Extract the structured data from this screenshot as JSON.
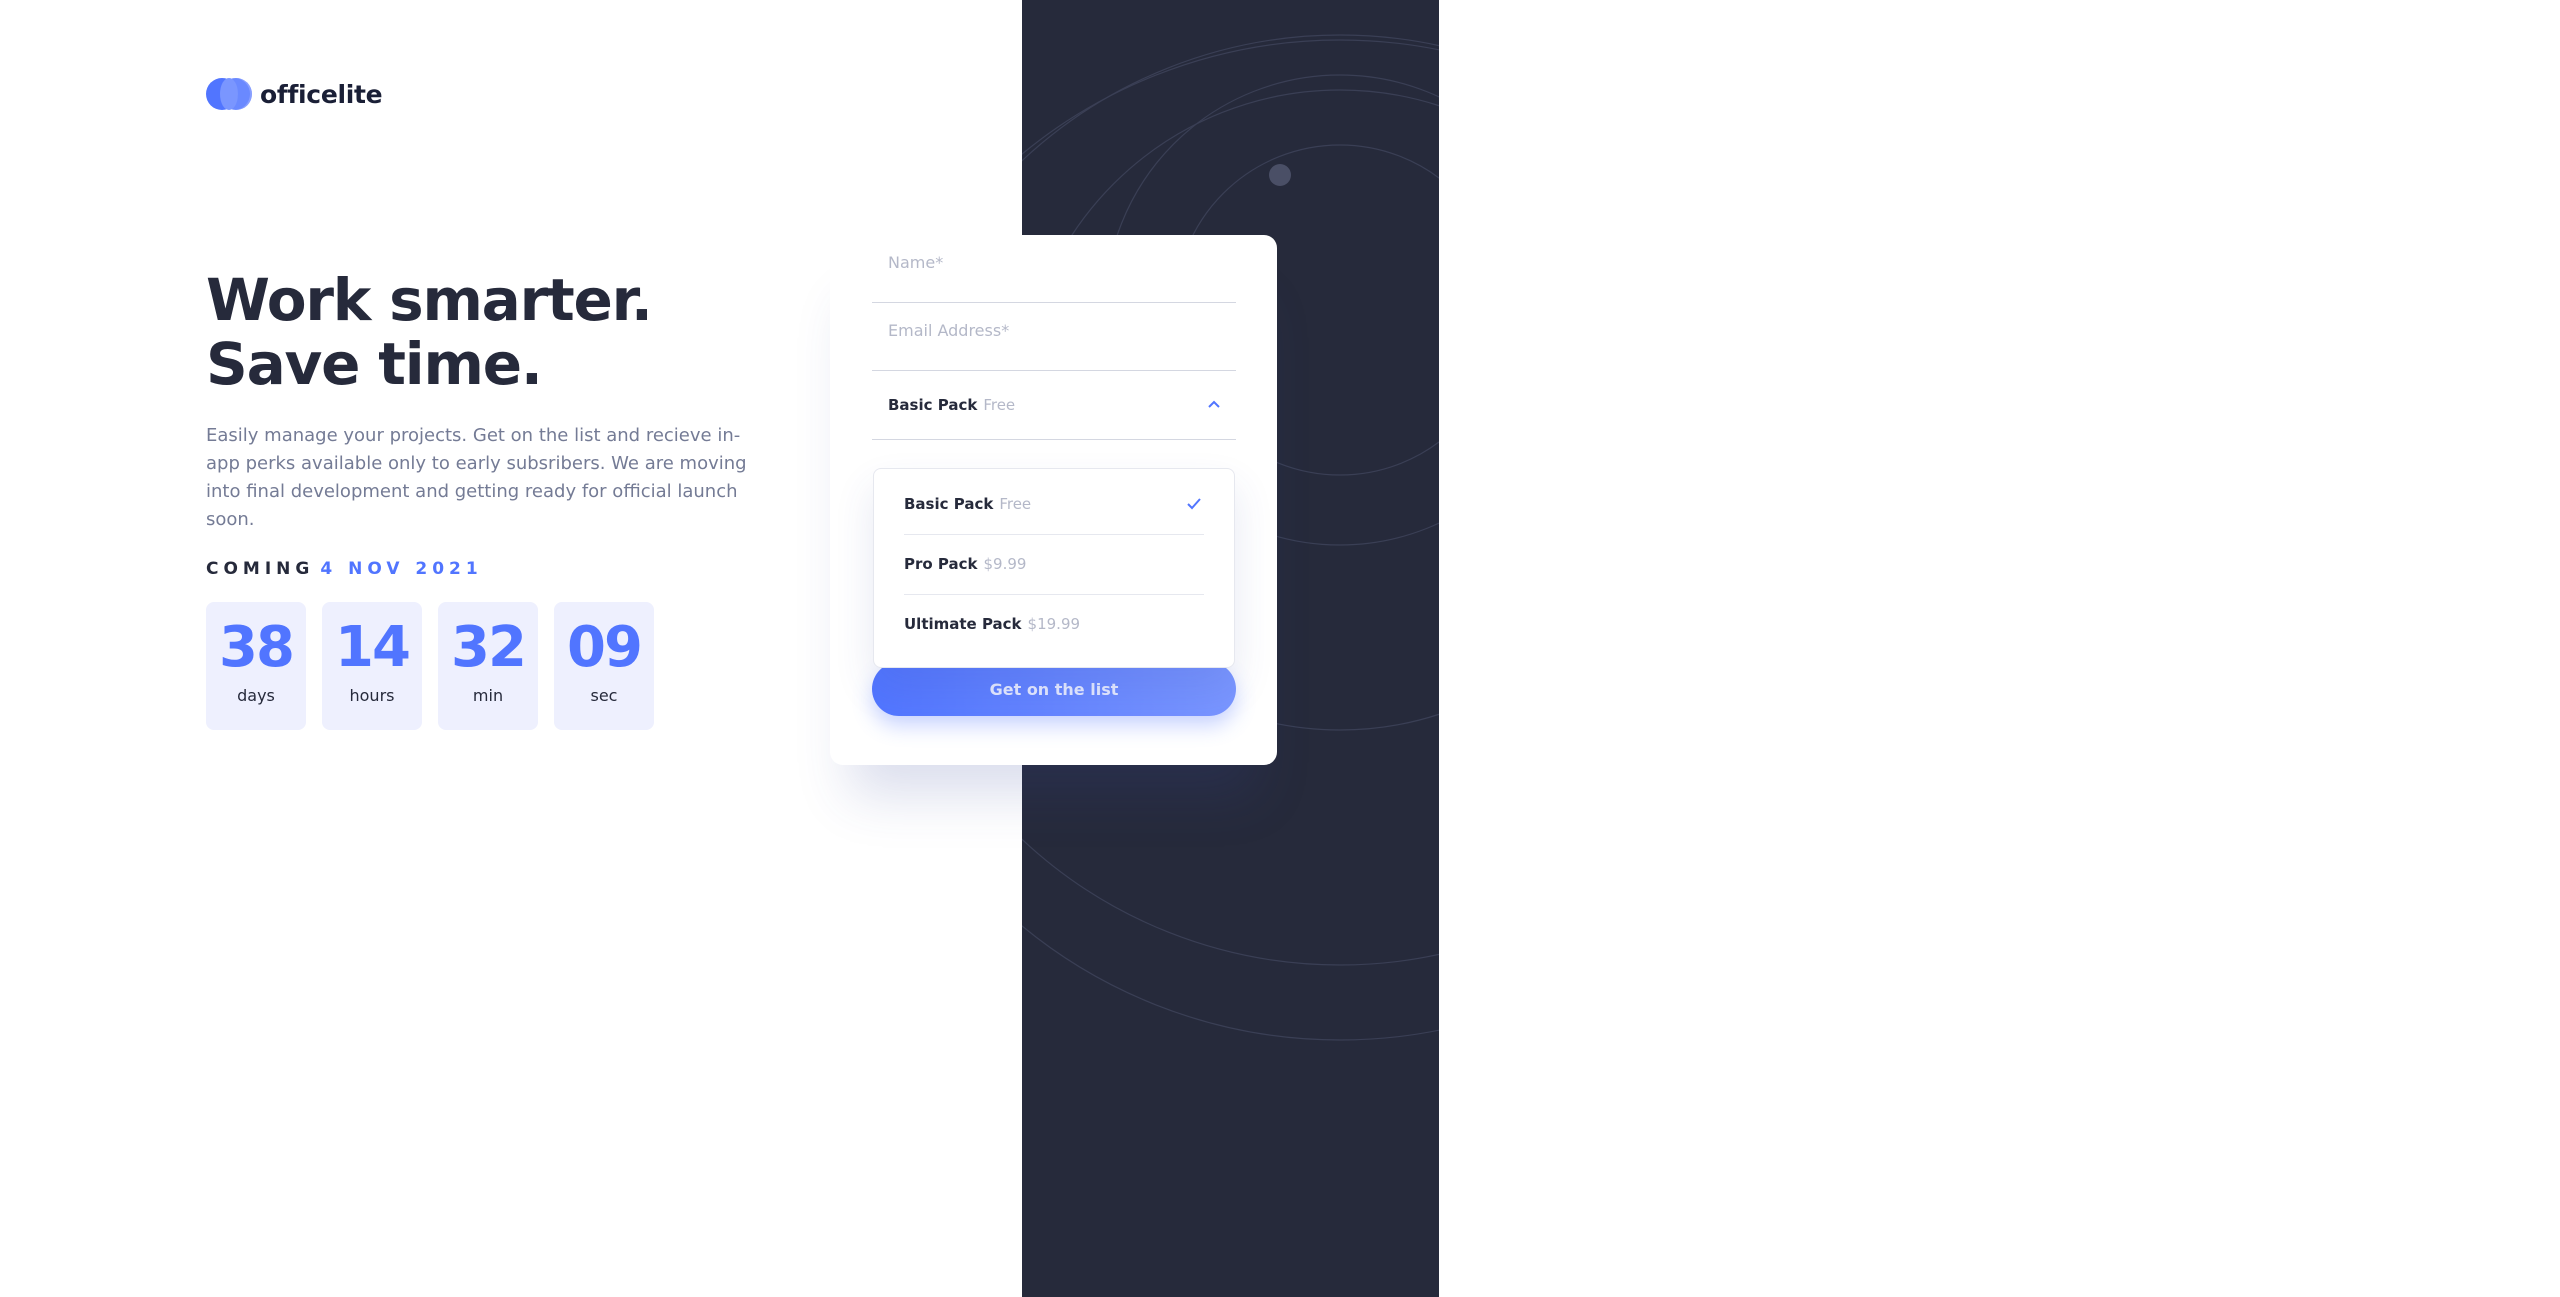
{
  "brand": {
    "name": "officelite",
    "accent": "#5175ff",
    "dark": "#262a3b"
  },
  "hero": {
    "headline": "Work smarter. Save time.",
    "intro": "Easily manage your projects. Get on the list and recieve in-app perks available only to early subsribers. We are moving into final development and getting ready for official launch soon."
  },
  "coming": {
    "label": "COMING",
    "date": "4 NOV 2021"
  },
  "countdown": [
    {
      "value": "38",
      "label": "days"
    },
    {
      "value": "14",
      "label": "hours"
    },
    {
      "value": "32",
      "label": "min"
    },
    {
      "value": "09",
      "label": "sec"
    }
  ],
  "form": {
    "name_placeholder": "Name*",
    "email_placeholder": "Email Address*",
    "select": {
      "selected_name": "Basic Pack",
      "selected_price": "Free",
      "expanded": true
    },
    "options": [
      {
        "name": "Basic Pack",
        "price": "Free",
        "selected": true
      },
      {
        "name": "Pro Pack",
        "price": "$9.99",
        "selected": false
      },
      {
        "name": "Ultimate Pack",
        "price": "$19.99",
        "selected": false
      }
    ],
    "submit_label": "Get on the list"
  },
  "icons": {
    "logo": "officelite-logo-icon",
    "chevron": "chevron-up-icon",
    "check": "check-icon"
  }
}
